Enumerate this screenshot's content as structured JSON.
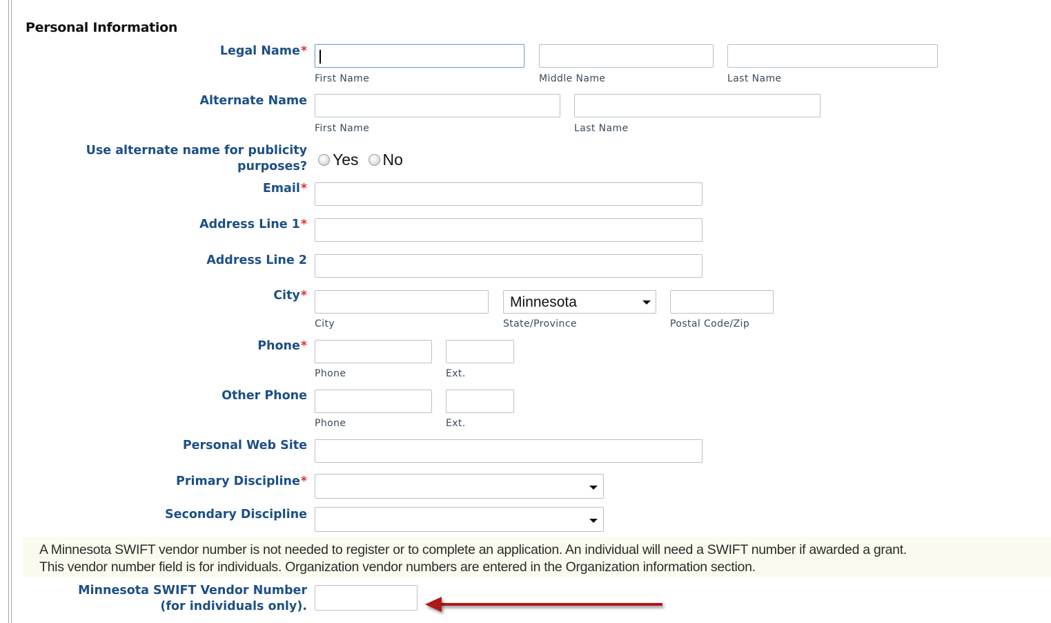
{
  "section": {
    "title": "Personal Information"
  },
  "required_mark": "*",
  "legal_name": {
    "label": "Legal Name",
    "first": "First Name",
    "middle": "Middle Name",
    "last": "Last Name",
    "first_value": ""
  },
  "alternate_name": {
    "label": "Alternate Name",
    "first": "First Name",
    "last": "Last Name"
  },
  "publicity": {
    "label_line1": "Use alternate name for publicity",
    "label_line2": "purposes?",
    "yes": "Yes",
    "no": "No"
  },
  "email": {
    "label": "Email",
    "value": ""
  },
  "address1": {
    "label": "Address Line 1",
    "value": ""
  },
  "address2": {
    "label": "Address Line 2",
    "value": ""
  },
  "city": {
    "label": "City",
    "city_sub": "City",
    "state_value": "Minnesota",
    "state_sub": "State/Province",
    "postal_sub": "Postal Code/Zip"
  },
  "phone": {
    "label": "Phone",
    "phone_sub": "Phone",
    "ext_sub": "Ext."
  },
  "other_phone": {
    "label": "Other Phone",
    "phone_sub": "Phone",
    "ext_sub": "Ext."
  },
  "website": {
    "label": "Personal Web Site",
    "value": ""
  },
  "primary_discipline": {
    "label": "Primary Discipline",
    "value": ""
  },
  "secondary_discipline": {
    "label": "Secondary Discipline",
    "value": ""
  },
  "note": {
    "line1": "A Minnesota SWIFT vendor number is not needed to register or to complete an application. An individual will need a SWIFT number if awarded a grant.",
    "line2": "This vendor number field is for individuals. Organization vendor numbers are entered in the Organization information section."
  },
  "swift": {
    "label_line1": "Minnesota SWIFT Vendor Number",
    "label_line2": "(for individuals only).",
    "value": ""
  },
  "colors": {
    "label": "#1c4f86",
    "required": "#e03030",
    "note_bg": "#fafbee",
    "arrow": "#b01818"
  }
}
